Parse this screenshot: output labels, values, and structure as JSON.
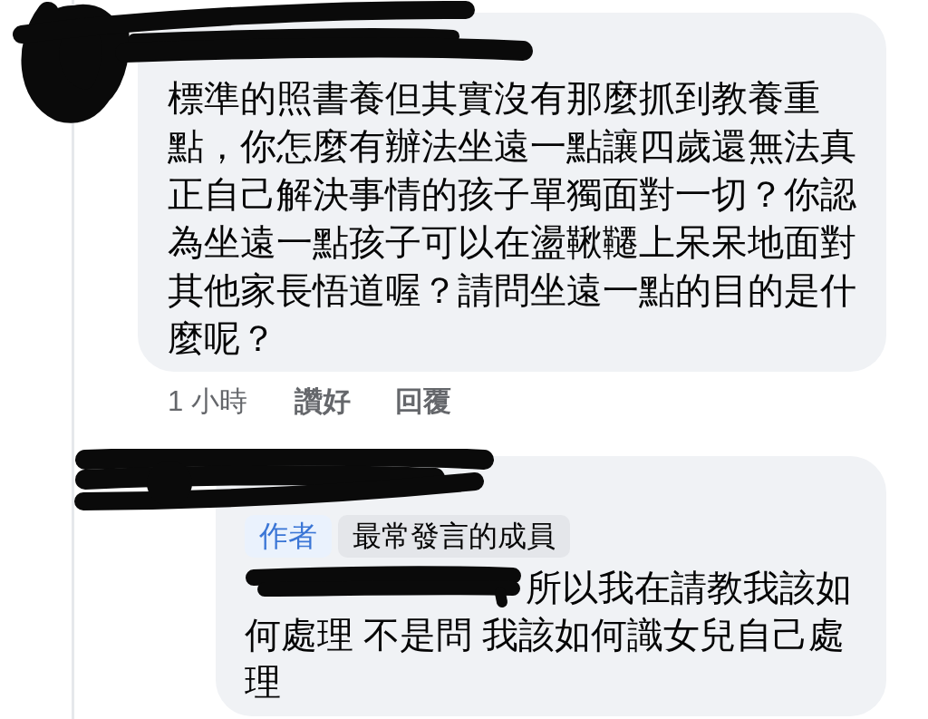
{
  "comments": [
    {
      "kind": "comment",
      "text": "標準的照書養但其實沒有那麼抓到教養重點，你怎麼有辦法坐遠一點讓四歲還無法真正自己解決事情的孩子單獨面對一切？你認為坐遠一點孩子可以在盪鞦韆上呆呆地面對其他家長悟道喔？請問坐遠一點的目的是什麼呢？",
      "meta": {
        "time": "1 小時",
        "actions": [
          "讚好",
          "回覆"
        ]
      }
    },
    {
      "kind": "reply",
      "badges": [
        {
          "kind": "author",
          "label": "作者"
        },
        {
          "kind": "top-contributor",
          "label": "最常發言的成員"
        }
      ],
      "text": "所以我在請教我該如何處理 不是問 我該如何識女兒自己處理"
    }
  ]
}
